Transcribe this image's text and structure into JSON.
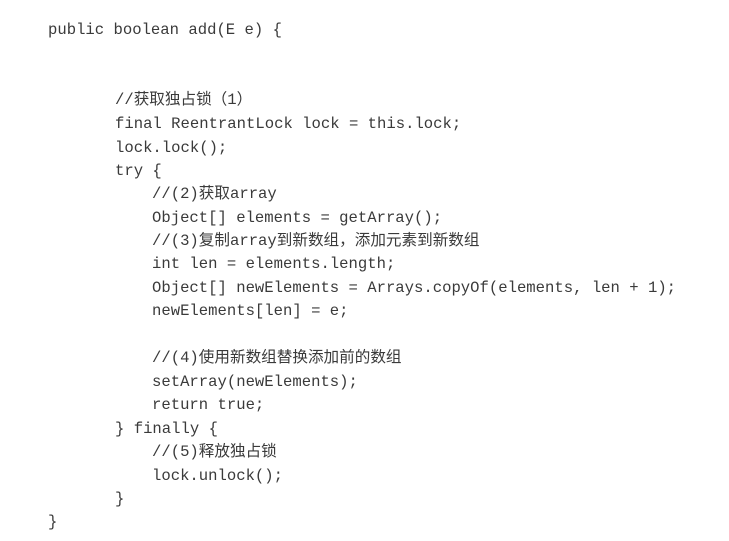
{
  "code_lines": [
    "public boolean add(E e) {",
    "//获取独占锁（1）",
    "final ReentrantLock lock = this.lock;",
    "lock.lock();",
    "try {",
    "//(2)获取array",
    "Object[] elements = getArray();",
    "//(3)复制array到新数组，添加元素到新数组",
    "int len = elements.length;",
    "Object[] newElements = Arrays.copyOf(elements, len + 1);",
    "newElements[len] = e;",
    "//(4)使用新数组替换添加前的数组",
    "setArray(newElements);",
    "return true;",
    "} finally {",
    "//(5)释放独占锁",
    "lock.unlock();",
    "}",
    "}"
  ]
}
